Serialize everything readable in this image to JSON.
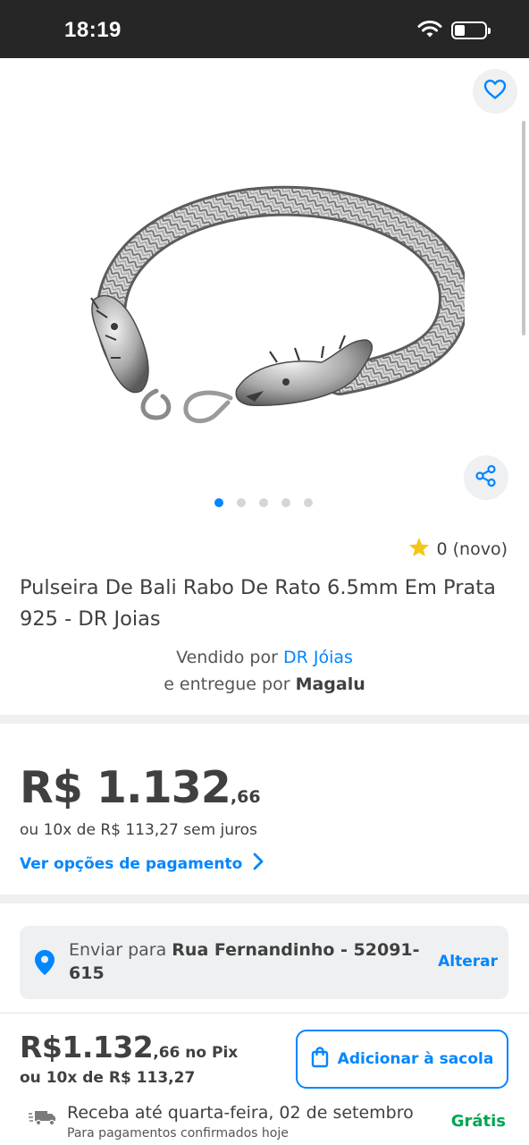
{
  "status_bar": {
    "time": "18:19",
    "wifi_icon": "wifi-icon",
    "battery_level": 0.35
  },
  "gallery": {
    "image_count": 5,
    "active_index": 0,
    "favorite_icon": "heart-outline-icon",
    "share_icon": "share-icon"
  },
  "rating": {
    "icon": "star-icon",
    "text": "0 (novo)"
  },
  "product": {
    "title": "Pulseira De Bali Rabo De Rato 6.5mm Em Prata 925 - DR Joias"
  },
  "seller": {
    "sold_by_prefix": "Vendido por",
    "seller_name": "DR Jóias",
    "delivered_prefix": "e entregue por",
    "delivered_by": "Magalu"
  },
  "price": {
    "currency_value": "R$ 1.132",
    "cents": ",66",
    "installments": "ou 10x de R$ 113,27 sem juros",
    "payment_options_link": "Ver opções de pagamento"
  },
  "shipping": {
    "prefix": "Enviar para",
    "address": "Rua Fernandinho - 52091-615",
    "change_label": "Alterar"
  },
  "bottom_bar": {
    "price_value": "R$1.132",
    "price_cents": ",66",
    "price_suffix": " no Pix",
    "installments": "ou 10x de R$ 113,27",
    "add_button_label": "Adicionar à sacola",
    "delivery_main": "Receba até quarta-feira, 02 de setembro",
    "delivery_sub": "Para pagamentos confirmados hoje",
    "delivery_price": "Grátis"
  },
  "colors": {
    "accent": "#0086ff",
    "text": "#404040",
    "free_green": "#00a650",
    "status_bar_bg": "#262626",
    "divider": "#eef0f2",
    "star": "#f5c518"
  }
}
